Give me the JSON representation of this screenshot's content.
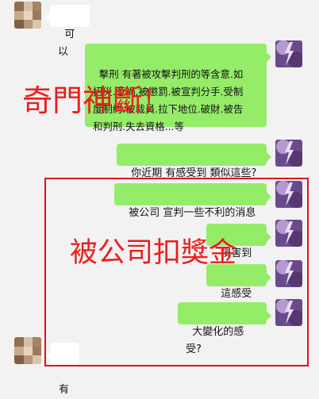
{
  "messages": [
    {
      "id": "m1",
      "side": "left",
      "text": "可以"
    },
    {
      "id": "m2",
      "side": "right",
      "text": "擊刑 有著被攻擊判刑的等含意.如\n招災.惹禍.被懲罰.被宣判分手.受制\n度制約.被裁員.拉下地位.破財.被告\n和判刑.失去資格...等"
    },
    {
      "id": "m3",
      "side": "right",
      "text": "你近期 有感受到 類似這些?"
    },
    {
      "id": "m4",
      "side": "right",
      "text": "被公司 宣判一些不利的消息"
    },
    {
      "id": "m5",
      "side": "right",
      "text": "損害到你"
    },
    {
      "id": "m6",
      "side": "right",
      "text": "這感受嗎"
    },
    {
      "id": "m7",
      "side": "right",
      "text": "大變化的感受?"
    },
    {
      "id": "m8",
      "side": "left",
      "text": "有"
    }
  ],
  "annotations": {
    "overlay1": "奇門神斷!",
    "overlay2": "被公司扣獎金",
    "accent_color": "#ee1c1c"
  },
  "colors": {
    "background": "#f2f2f2",
    "bubble_self": "#95ec69",
    "bubble_other": "#ffffff"
  }
}
